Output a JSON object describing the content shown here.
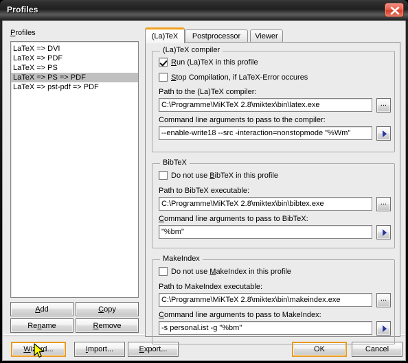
{
  "window": {
    "title": "Profiles",
    "close_icon": "close-icon"
  },
  "left": {
    "profiles_label": "Profiles",
    "profiles_label_mnemonic": "P",
    "items": [
      "LaTeX => DVI",
      "LaTeX => PDF",
      "LaTeX => PS",
      "LaTeX => PS => PDF",
      "LaTeX => pst-pdf => PDF"
    ],
    "selected_index": 3,
    "buttons": {
      "add": "Add",
      "copy": "Copy",
      "rename": "Rename",
      "remove": "Remove"
    }
  },
  "tabs": [
    {
      "label": "(La)TeX",
      "active": true
    },
    {
      "label": "Postprocessor",
      "active": false
    },
    {
      "label": "Viewer",
      "active": false
    }
  ],
  "latex_tab": {
    "compiler_group": {
      "title": "(La)TeX compiler",
      "run_checkbox": {
        "label": "Run (La)TeX in this profile",
        "checked": true
      },
      "stop_checkbox": {
        "label": "Stop Compilation, if LaTeX-Error occures",
        "checked": false
      },
      "path_label": "Path to the (La)TeX compiler:",
      "path_value": "C:\\Programme\\MiKTeX 2.8\\miktex\\bin\\latex.exe",
      "args_label": "Command line arguments to pass to the compiler:",
      "args_value": "--enable-write18 --src -interaction=nonstopmode \"%Wm\"",
      "browse_button": "...",
      "arrow_button": "arrow-right-icon"
    },
    "bibtex_group": {
      "title": "BibTeX",
      "disable_checkbox": {
        "label": "Do not use BibTeX in this profile",
        "checked": false
      },
      "path_label": "Path to BibTeX executable:",
      "path_value": "C:\\Programme\\MiKTeX 2.8\\miktex\\bin\\bibtex.exe",
      "args_label": "Command line arguments to pass to BibTeX:",
      "args_value": "\"%bm\"",
      "browse_button": "...",
      "arrow_button": "arrow-right-icon"
    },
    "makeindex_group": {
      "title": "MakeIndex",
      "disable_checkbox": {
        "label": "Do not use MakeIndex in this profile",
        "checked": false
      },
      "path_label": "Path to MakeIndex executable:",
      "path_value": "C:\\Programme\\MiKTeX 2.8\\miktex\\bin\\makeindex.exe",
      "args_label": "Command line arguments to pass to MakeIndex:",
      "args_value": "-s personal.ist -g \"%bm\"",
      "browse_button": "...",
      "arrow_button": "arrow-right-icon"
    }
  },
  "footer": {
    "wizard": "Wizard...",
    "import": "Import...",
    "export": "Export...",
    "ok": "OK",
    "cancel": "Cancel"
  },
  "colors": {
    "accent_focus": "#e89a1c",
    "tab_active_top": "#f0a01e",
    "close_red": "#d4412c",
    "selection_gray": "#c0c0c0",
    "arrow_blue": "#2736a3",
    "cursor_yellow": "#ffff00"
  }
}
